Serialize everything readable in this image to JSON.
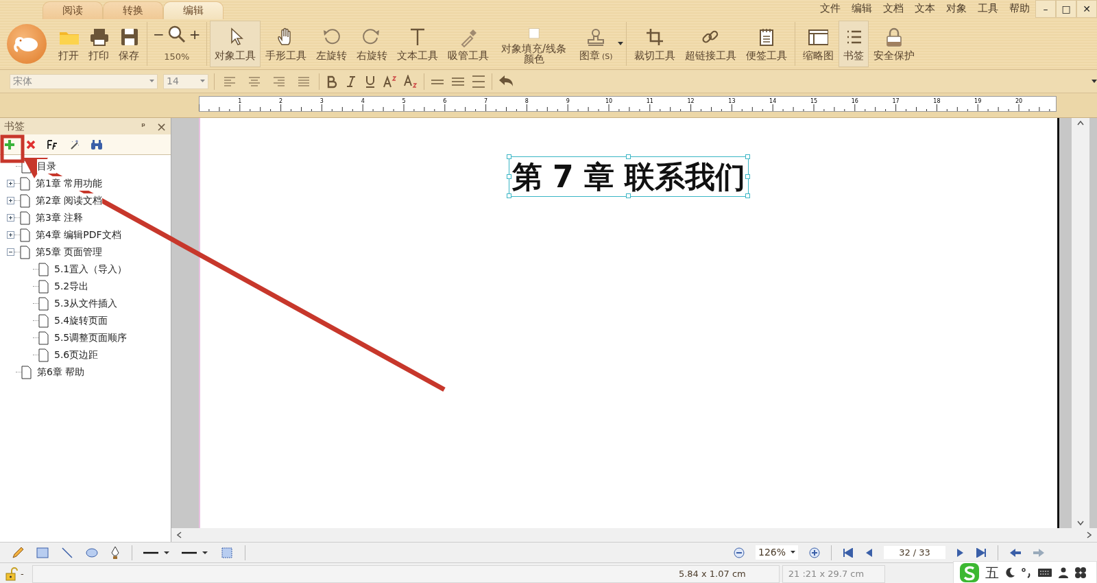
{
  "tabs": [
    {
      "label": "阅读",
      "selected": false
    },
    {
      "label": "转换",
      "selected": false
    },
    {
      "label": "编辑",
      "selected": true
    }
  ],
  "menu": [
    "文件",
    "编辑",
    "文档",
    "文本",
    "对象",
    "工具",
    "帮助"
  ],
  "window_buttons": [
    "–",
    "□",
    "✕"
  ],
  "toolbar": {
    "file": [
      {
        "label": "打开"
      },
      {
        "label": "打印"
      },
      {
        "label": "保存"
      }
    ],
    "zoom": {
      "minus": "−",
      "plus": "+",
      "value": "150%"
    },
    "tools": [
      {
        "label": "对象工具",
        "selected": true
      },
      {
        "label": "手形工具",
        "selected": false
      },
      {
        "label": "左旋转",
        "selected": false
      },
      {
        "label": "右旋转",
        "selected": false
      },
      {
        "label": "文本工具",
        "selected": false
      },
      {
        "label": "吸管工具",
        "selected": false
      },
      {
        "label": "对象填充/线条颜色",
        "selected": false
      },
      {
        "label": "图章",
        "suffix": "(S)",
        "selected": false
      }
    ],
    "tools2": [
      {
        "label": "裁切工具",
        "selected": false
      },
      {
        "label": "超链接工具",
        "selected": false
      },
      {
        "label": "便签工具",
        "selected": false
      }
    ],
    "view": [
      {
        "label": "缩略图",
        "selected": false
      },
      {
        "label": "书签",
        "selected": true
      },
      {
        "label": "安全保护",
        "selected": false
      }
    ]
  },
  "format_bar": {
    "font": "宋体",
    "size": "14"
  },
  "ruler": [
    "1",
    "2",
    "3",
    "4",
    "5",
    "6",
    "7",
    "8",
    "9",
    "10",
    "11",
    "12",
    "13",
    "14",
    "15",
    "16",
    "17",
    "18",
    "19",
    "20"
  ],
  "bookmarks": {
    "title": "书签",
    "pin": "ᵖ",
    "close": "×",
    "items": [
      {
        "label": "目录"
      },
      {
        "label": "第1章 常用功能",
        "expanded": false
      },
      {
        "label": "第2章 阅读文档",
        "expanded": false
      },
      {
        "label": "第3章 注释",
        "expanded": false
      },
      {
        "label": "第4章 编辑PDF文档",
        "expanded": false
      },
      {
        "label": "第5章 页面管理",
        "expanded": true,
        "children": [
          {
            "label": "5.1置入（导入）"
          },
          {
            "label": "5.2导出"
          },
          {
            "label": "5.3从文件插入"
          },
          {
            "label": "5.4旋转页面"
          },
          {
            "label": "5.5调整页面顺序"
          },
          {
            "label": "5.6页边距"
          }
        ]
      },
      {
        "label": "第6章 帮助"
      }
    ]
  },
  "document": {
    "heading": "第 7 章  联系我们"
  },
  "bottom_bar": {
    "zoom": "126%",
    "page": "32 / 33"
  },
  "status_bar": {
    "lock_state": "-",
    "selection_size": "5.84 x 1.07 cm",
    "page_size": "21 :21 x 29.7 cm",
    "ime_mode": "五"
  }
}
